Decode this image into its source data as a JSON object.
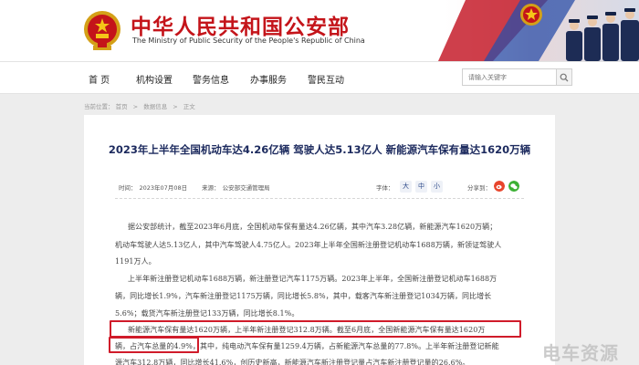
{
  "header": {
    "title": "中华人民共和国公安部",
    "subtitle": "The Ministry of Public Security of the People's Republic of China"
  },
  "nav": {
    "items": [
      {
        "label": "首 页"
      },
      {
        "label": "机构设置"
      },
      {
        "label": "警务信息"
      },
      {
        "label": "办事服务"
      },
      {
        "label": "警民互动"
      }
    ],
    "search_placeholder": "请输入关键字"
  },
  "breadcrumb": {
    "prefix": "当前位置：",
    "items": [
      "首页",
      "数据信息",
      "正文"
    ]
  },
  "article": {
    "title": "2023年上半年全国机动车达4.26亿辆 驾驶人达5.13亿人 新能源汽车保有量达1620万辆",
    "time_label": "时间：",
    "time": "2023年07月08日",
    "source_label": "来源：",
    "source": "公安部交通管理局",
    "font_label": "字体：",
    "font_sizes": [
      "大",
      "中",
      "小"
    ],
    "share_label": "分享到：",
    "lines": [
      "据公安部统计，截至2023年6月底，全国机动车保有量达4.26亿辆，其中汽车3.28亿辆，新能源汽车1620万辆；",
      "机动车驾驶人达5.13亿人，其中汽车驾驶人4.75亿人。2023年上半年全国新注册登记机动车1688万辆，新领证驾驶人",
      "1191万人。",
      "上半年新注册登记机动车1688万辆，新注册登记汽车1175万辆。2023年上半年，全国新注册登记机动车1688万",
      "辆，同比增长1.9%，汽车新注册登记1175万辆，同比增长5.8%，其中，载客汽车新注册登记1034万辆，同比增长",
      "5.6%；载货汽车新注册登记133万辆，同比增长8.1%。",
      "新能源汽车保有量达1620万辆，上半年新注册登记312.8万辆。截至6月底，全国新能源汽车保有量达1620万",
      "辆，占汽车总量的4.9%，其中，纯电动汽车保有量1259.4万辆，占新能源汽车总量的77.8%。上半年新注册登记新能",
      "源汽车312.8万辆，同比增长41.6%，创历史新高，新能源汽车新注册登记量占汽车新注册登记量的26.6%。"
    ]
  },
  "watermark": "电车资源",
  "colors": {
    "brand_red": "#c4141a",
    "title_navy": "#1c2a5e",
    "highlight_red": "#d01b2a"
  }
}
